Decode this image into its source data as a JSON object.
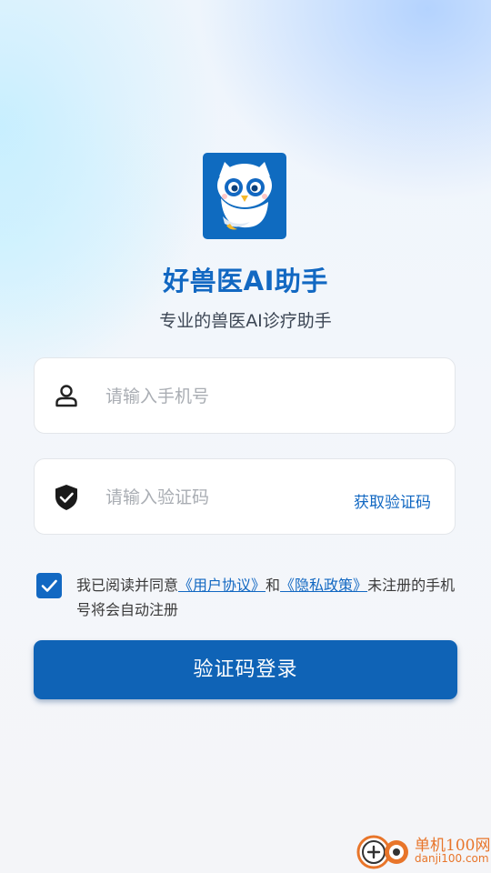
{
  "app": {
    "title": "好兽医AI助手",
    "subtitle": "专业的兽医AI诊疗助手"
  },
  "phone_field": {
    "placeholder": "请输入手机号",
    "value": "",
    "icon": "person-icon"
  },
  "code_field": {
    "placeholder": "请输入验证码",
    "value": "",
    "icon": "shield-check-icon",
    "get_code_label": "获取验证码"
  },
  "agreement": {
    "checked": true,
    "prefix": "我已阅读并同意",
    "user_agreement": "《用户协议》",
    "conjunction": "和",
    "privacy_policy": "《隐私政策》",
    "suffix": "未注册的手机号将会自动注册"
  },
  "login_button": {
    "label": "验证码登录"
  },
  "watermark": {
    "name": "单机100网",
    "url": "danji100.com"
  },
  "colors": {
    "brand": "#1268c2",
    "button": "#0f63b6",
    "watermark": "#e8752a"
  }
}
